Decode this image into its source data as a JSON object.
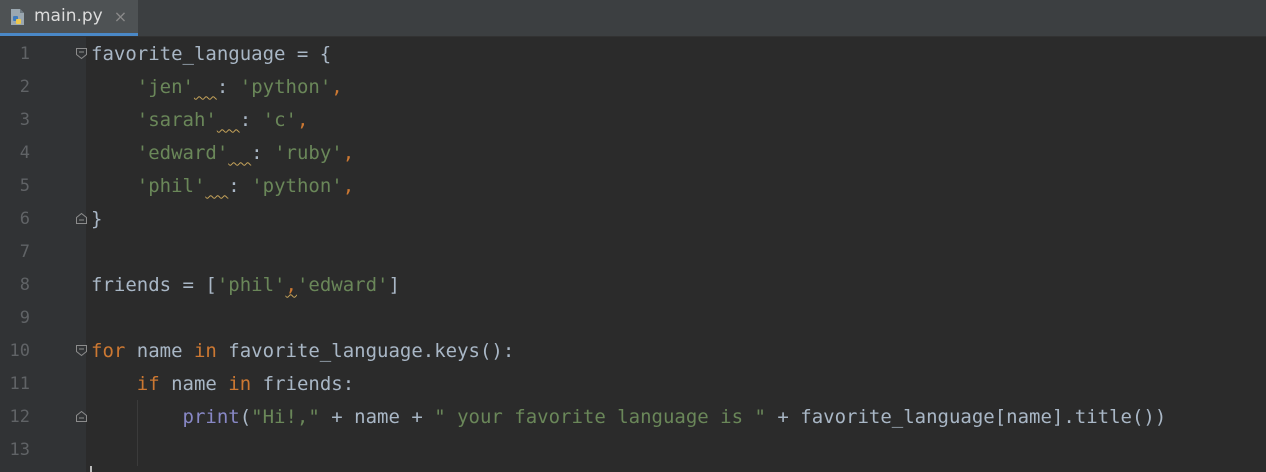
{
  "tab": {
    "filename": "main.py",
    "close_glyph": "×",
    "icon": "python-file-icon"
  },
  "colors": {
    "background": "#2b2b2b",
    "gutter": "#313335",
    "line_number": "#606366",
    "identifier": "#a9b7c6",
    "string": "#6a8759",
    "keyword": "#cc7832",
    "builtin": "#8888c6",
    "tab_underline": "#4a88c7"
  },
  "lines": [
    {
      "n": "1",
      "fold": "start",
      "tokens": [
        {
          "t": "favorite_language = {",
          "c": "plain"
        }
      ]
    },
    {
      "n": "2",
      "fold": "",
      "tokens": [
        {
          "t": "    ",
          "c": "plain"
        },
        {
          "t": "'jen'",
          "c": "str"
        },
        {
          "t": "  ",
          "c": "plain",
          "weak": true
        },
        {
          "t": ": ",
          "c": "plain"
        },
        {
          "t": "'python'",
          "c": "str"
        },
        {
          "t": ",",
          "c": "punct"
        }
      ]
    },
    {
      "n": "3",
      "fold": "",
      "tokens": [
        {
          "t": "    ",
          "c": "plain"
        },
        {
          "t": "'sarah'",
          "c": "str"
        },
        {
          "t": "  ",
          "c": "plain",
          "weak": true
        },
        {
          "t": ": ",
          "c": "plain"
        },
        {
          "t": "'c'",
          "c": "str"
        },
        {
          "t": ",",
          "c": "punct"
        }
      ]
    },
    {
      "n": "4",
      "fold": "",
      "tokens": [
        {
          "t": "    ",
          "c": "plain"
        },
        {
          "t": "'edward'",
          "c": "str"
        },
        {
          "t": "  ",
          "c": "plain",
          "weak": true
        },
        {
          "t": ": ",
          "c": "plain"
        },
        {
          "t": "'ruby'",
          "c": "str"
        },
        {
          "t": ",",
          "c": "punct"
        }
      ]
    },
    {
      "n": "5",
      "fold": "",
      "tokens": [
        {
          "t": "    ",
          "c": "plain"
        },
        {
          "t": "'phil'",
          "c": "str"
        },
        {
          "t": "  ",
          "c": "plain",
          "weak": true
        },
        {
          "t": ": ",
          "c": "plain"
        },
        {
          "t": "'python'",
          "c": "str"
        },
        {
          "t": ",",
          "c": "punct"
        }
      ]
    },
    {
      "n": "6",
      "fold": "end",
      "tokens": [
        {
          "t": "}",
          "c": "plain"
        }
      ]
    },
    {
      "n": "7",
      "fold": "",
      "tokens": []
    },
    {
      "n": "8",
      "fold": "",
      "tokens": [
        {
          "t": "friends = [",
          "c": "plain"
        },
        {
          "t": "'phil'",
          "c": "str"
        },
        {
          "t": ",",
          "c": "punct",
          "weak": true
        },
        {
          "t": "'edward'",
          "c": "str"
        },
        {
          "t": "]",
          "c": "plain"
        }
      ]
    },
    {
      "n": "9",
      "fold": "",
      "tokens": []
    },
    {
      "n": "10",
      "fold": "start",
      "tokens": [
        {
          "t": "for",
          "c": "kw"
        },
        {
          "t": " name ",
          "c": "plain"
        },
        {
          "t": "in",
          "c": "kw"
        },
        {
          "t": " favorite_language.keys():",
          "c": "plain"
        }
      ]
    },
    {
      "n": "11",
      "fold": "",
      "tokens": [
        {
          "t": "    ",
          "c": "plain"
        },
        {
          "t": "if",
          "c": "kw"
        },
        {
          "t": " name ",
          "c": "plain"
        },
        {
          "t": "in",
          "c": "kw"
        },
        {
          "t": " friends:",
          "c": "plain"
        }
      ]
    },
    {
      "n": "12",
      "fold": "end",
      "tokens": [
        {
          "t": "        ",
          "c": "plain"
        },
        {
          "t": "print",
          "c": "func"
        },
        {
          "t": "(",
          "c": "plain"
        },
        {
          "t": "\"Hi!,\"",
          "c": "str"
        },
        {
          "t": " + name + ",
          "c": "plain"
        },
        {
          "t": "\" your favorite language is \"",
          "c": "str"
        },
        {
          "t": " + favorite_language[name].title())",
          "c": "plain"
        }
      ]
    },
    {
      "n": "13",
      "fold": "",
      "tokens": []
    }
  ]
}
